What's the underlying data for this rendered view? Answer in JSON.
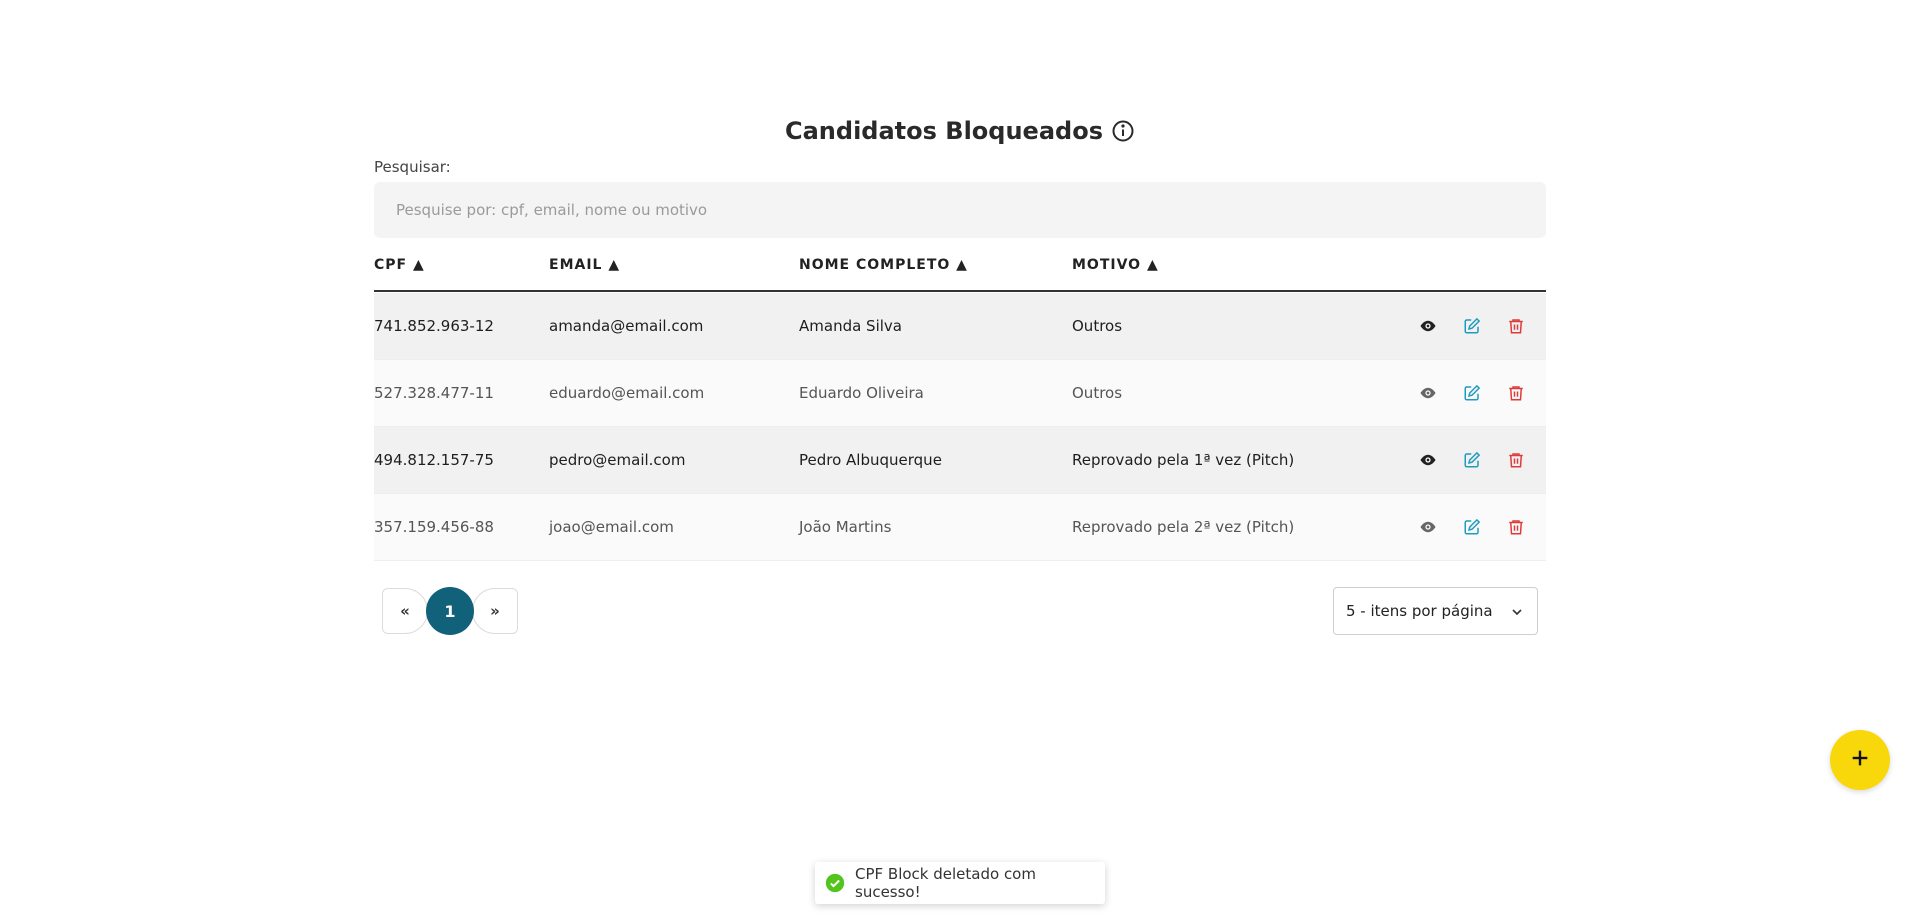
{
  "page": {
    "title": "Candidatos Bloqueados",
    "search_label": "Pesquisar:",
    "search_placeholder": "Pesquise por: cpf, email, nome ou motivo",
    "search_value": ""
  },
  "table": {
    "columns": [
      {
        "label": "CPF ▲"
      },
      {
        "label": "EMAIL ▲"
      },
      {
        "label": "NOME COMPLETO ▲"
      },
      {
        "label": "MOTIVO ▲"
      }
    ],
    "rows": [
      {
        "cpf": "741.852.963-12",
        "email": "amanda@email.com",
        "nome": "Amanda Silva",
        "motivo": "Outros"
      },
      {
        "cpf": "527.328.477-11",
        "email": "eduardo@email.com",
        "nome": "Eduardo Oliveira",
        "motivo": "Outros"
      },
      {
        "cpf": "494.812.157-75",
        "email": "pedro@email.com",
        "nome": "Pedro Albuquerque",
        "motivo": "Reprovado pela 1ª vez (Pitch)"
      },
      {
        "cpf": "357.159.456-88",
        "email": "joao@email.com",
        "nome": "João Martins",
        "motivo": "Reprovado pela 2ª vez (Pitch)"
      }
    ]
  },
  "pagination": {
    "prev_label": "«",
    "current_page": "1",
    "next_label": "»",
    "per_page_label": "5 - itens por página"
  },
  "toast": {
    "message": "CPF Block deletado com sucesso!"
  },
  "icons": {
    "info": "info-icon",
    "view": "eye-icon",
    "edit": "edit-icon",
    "delete": "trash-icon",
    "add": "plus-icon",
    "chevron": "chevron-down-icon",
    "success": "check-circle-icon"
  },
  "colors": {
    "primary": "#12617a",
    "edit": "#1e9bbf",
    "delete": "#e03a3a",
    "fab": "#f8d70b",
    "success": "#52c41a"
  }
}
